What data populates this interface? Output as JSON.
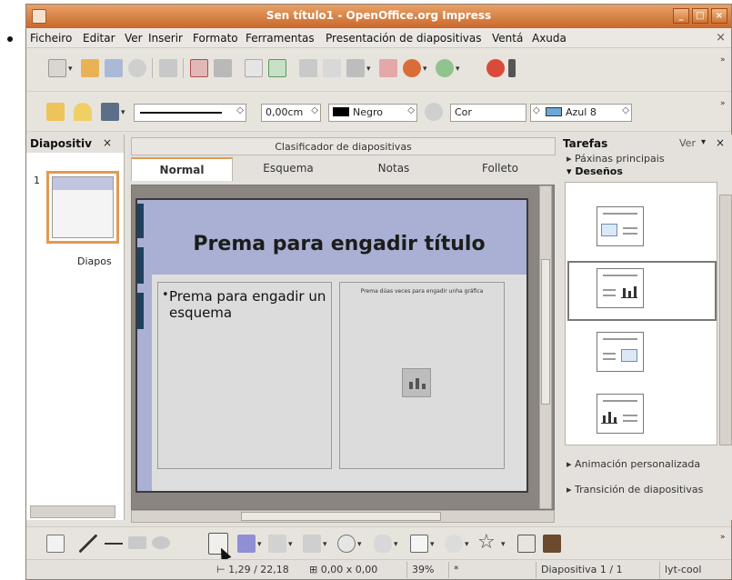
{
  "window": {
    "title": "Sen título1 - OpenOffice.org Impress",
    "minimize": "_",
    "maximize": "□",
    "close": "×"
  },
  "menu": {
    "items": [
      "Ficheiro",
      "Editar",
      "Ver",
      "Inserir",
      "Formato",
      "Ferramentas",
      "Presentación de diapositivas",
      "Ventá",
      "Axuda"
    ],
    "doc_close": "×"
  },
  "format_toolbar": {
    "line_width": "0,00cm",
    "line_color": "Negro",
    "area_fill": "Cor",
    "area_color": "Azul 8"
  },
  "slides_pane": {
    "title": "Diapositiv",
    "close": "×",
    "slide_number": "1",
    "slide_label": "Diapos"
  },
  "view_tabs": {
    "top_label": "Clasificador de diapositivas",
    "tabs": [
      "Normal",
      "Esquema",
      "Notas",
      "Folleto"
    ]
  },
  "slide": {
    "title_placeholder": "Prema para engadir título",
    "outline_bullet": "•",
    "outline_placeholder": "Prema para engadir un esquema",
    "chart_placeholder": "Prema dúas veces para engadir unha gráfica"
  },
  "tasks_pane": {
    "title": "Tarefas",
    "view_menu": "Ver",
    "view_arrow": "▾",
    "close": "×",
    "sections": {
      "master_pages": "Páxinas principais",
      "layouts": "Deseños",
      "custom_animation": "Animación personalizada",
      "slide_transition": "Transición de diapositivas"
    },
    "arrow_collapsed": "▸",
    "arrow_expanded": "▾"
  },
  "statusbar": {
    "position": "1,29 / 22,18",
    "size": "0,00 x 0,00",
    "zoom": "39%",
    "modified": "*",
    "slide_indicator": "Diapositiva 1 / 1",
    "layout_name": "lyt-cool"
  },
  "colors": {
    "title_bar": "#c9672a",
    "accent": "#e19a52",
    "slide_band": "#a9b0d3"
  }
}
